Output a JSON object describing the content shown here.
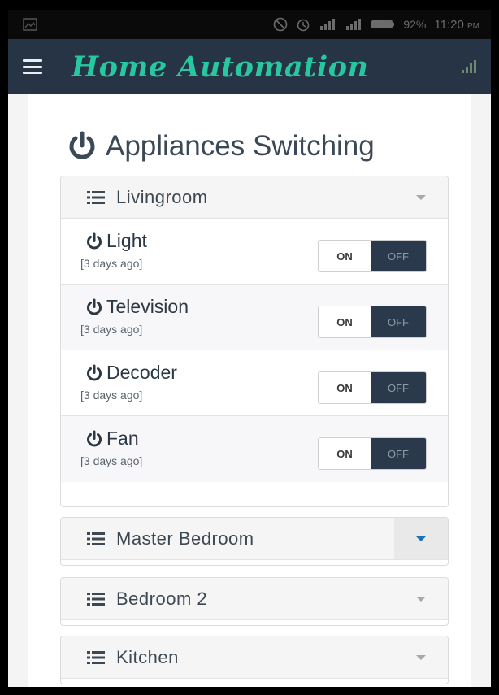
{
  "status_bar": {
    "battery_percent": "92%",
    "time": "11:20",
    "time_suffix": "PM"
  },
  "app_bar": {
    "title": "Home Automation"
  },
  "page": {
    "heading": "Appliances Switching"
  },
  "rooms": [
    {
      "name": "Livingroom",
      "expanded": true,
      "appliances": [
        {
          "name": "Light",
          "last_changed": "[3 days ago]",
          "on_label": "ON",
          "off_label": "OFF",
          "state": "off"
        },
        {
          "name": "Television",
          "last_changed": "[3 days ago]",
          "on_label": "ON",
          "off_label": "OFF",
          "state": "off"
        },
        {
          "name": "Decoder",
          "last_changed": "[3 days ago]",
          "on_label": "ON",
          "off_label": "OFF",
          "state": "off"
        },
        {
          "name": "Fan",
          "last_changed": "[3 days ago]",
          "on_label": "ON",
          "off_label": "OFF",
          "state": "off"
        }
      ]
    },
    {
      "name": "Master Bedroom",
      "expanded": false
    },
    {
      "name": "Bedroom 2",
      "expanded": false
    },
    {
      "name": "Kitchen",
      "expanded": false
    }
  ],
  "colors": {
    "app_bar_bg": "#263445",
    "title_accent": "#27c8a0",
    "toggle_off_bg": "#2a394b",
    "active_caret": "#1f6fb2"
  }
}
